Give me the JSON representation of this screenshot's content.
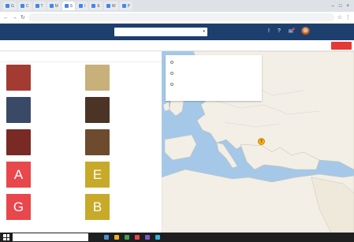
{
  "browser": {
    "tabs": [
      {
        "label": "G"
      },
      {
        "label": "C"
      },
      {
        "label": "T"
      },
      {
        "label": "M"
      },
      {
        "label": "S"
      },
      {
        "label": "I"
      },
      {
        "label": "E"
      },
      {
        "label": "W"
      },
      {
        "label": "P"
      }
    ],
    "url": "",
    "window_controls": [
      "–",
      "□",
      "×"
    ]
  },
  "header": {
    "brand": "",
    "search_value": "",
    "icons": [
      "bell-icon",
      "help-icon",
      "notifications-icon",
      "avatar"
    ]
  },
  "nav": {
    "left_label": "",
    "links": [
      "",
      "",
      "",
      "",
      "",
      "",
      "",
      "",
      "",
      "",
      ""
    ],
    "cta": ""
  },
  "list": {
    "header_left": "",
    "header_right": "",
    "cards": [
      {
        "type": "photo",
        "color": "#a33b32",
        "name": "",
        "sub": "",
        "meta": ""
      },
      {
        "type": "photo",
        "color": "#c7b07a",
        "name": "",
        "sub": "",
        "meta": ""
      },
      {
        "type": "photo",
        "color": "#3a4a66",
        "name": "",
        "sub": "",
        "meta": ""
      },
      {
        "type": "photo",
        "color": "#4b3426",
        "name": "",
        "sub": "",
        "meta": ""
      },
      {
        "type": "photo",
        "color": "#7a2a25",
        "name": "",
        "sub": "",
        "meta": ""
      },
      {
        "type": "photo",
        "color": "#6e4b2e",
        "name": "",
        "sub": "",
        "meta": ""
      },
      {
        "type": "letter",
        "letter": "A",
        "color": "#e8474c",
        "name": "",
        "sub": "",
        "meta": ""
      },
      {
        "type": "letter",
        "letter": "E",
        "color": "#c9a92a",
        "name": "",
        "sub": "",
        "meta": ""
      },
      {
        "type": "letter",
        "letter": "G",
        "color": "#e8474c",
        "name": "",
        "sub": "",
        "meta": ""
      },
      {
        "type": "letter",
        "letter": "B",
        "color": "#c9a92a",
        "name": "",
        "sub": "",
        "meta": ""
      }
    ]
  },
  "map_panel": {
    "rows": [
      "",
      "",
      ""
    ],
    "right_label": "",
    "link": ""
  },
  "marker": {
    "label": "7"
  },
  "taskbar": {
    "search_placeholder": "",
    "app_colors": [
      "#4a90d9",
      "#f2b01e",
      "#3fa34d",
      "#e8474c",
      "#7a5cc8",
      "#2fb5e0"
    ],
    "tray": ""
  },
  "colors": {
    "header": "#1c3f6e",
    "accent": "#e53935",
    "map_sea": "#a5c8e8",
    "map_land": "#f3efe6"
  }
}
